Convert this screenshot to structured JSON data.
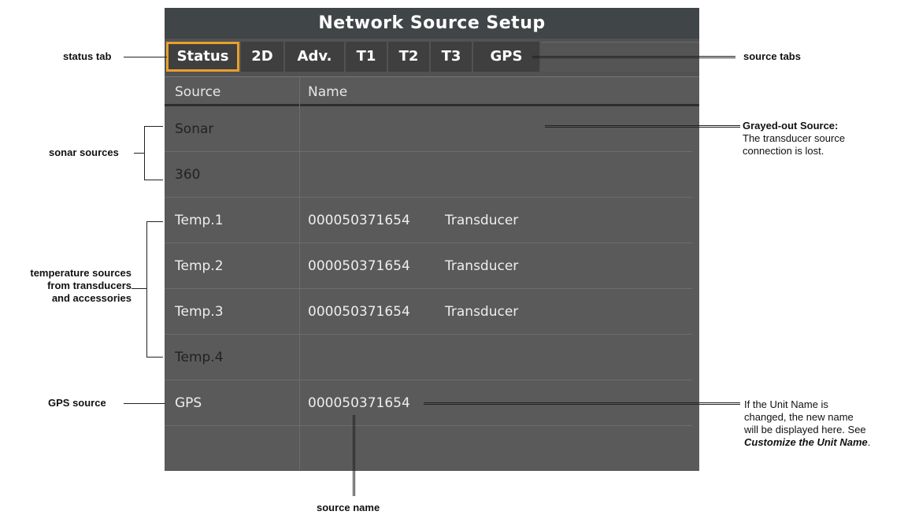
{
  "window": {
    "title": "Network Source Setup"
  },
  "tabs": [
    {
      "label": "Status",
      "active": true
    },
    {
      "label": "2D",
      "active": false
    },
    {
      "label": "Adv.",
      "active": false
    },
    {
      "label": "T1",
      "active": false
    },
    {
      "label": "T2",
      "active": false
    },
    {
      "label": "T3",
      "active": false
    },
    {
      "label": "GPS",
      "active": false
    }
  ],
  "table": {
    "columns": [
      "Source",
      "Name"
    ],
    "rows": [
      {
        "source": "Sonar",
        "id": "",
        "name": "",
        "grayed": true
      },
      {
        "source": "360",
        "id": "",
        "name": "",
        "grayed": true
      },
      {
        "source": "Temp.1",
        "id": "000050371654",
        "name": "Transducer",
        "grayed": false
      },
      {
        "source": "Temp.2",
        "id": "000050371654",
        "name": "Transducer",
        "grayed": false
      },
      {
        "source": "Temp.3",
        "id": "000050371654",
        "name": "Transducer",
        "grayed": false
      },
      {
        "source": "Temp.4",
        "id": "",
        "name": "",
        "grayed": true
      },
      {
        "source": "GPS",
        "id": "000050371654",
        "name": "",
        "grayed": false
      },
      {
        "source": "",
        "id": "",
        "name": "",
        "grayed": false
      }
    ]
  },
  "callouts": {
    "status_tab": "status tab",
    "source_tabs": "source tabs",
    "sonar_sources": "sonar sources",
    "temperature_sources": [
      "temperature sources",
      "from transducers",
      "and accessories"
    ],
    "gps_source": "GPS source",
    "source_name": "source name",
    "grayed_out_title": "Grayed-out Source:",
    "grayed_out_lines": [
      "The transducer source",
      "connection is lost."
    ],
    "unit_name_lines": [
      "If the Unit Name is",
      "changed, the new name",
      "will be displayed here. See"
    ],
    "unit_name_link": "Customize the Unit Name",
    "unit_name_end": "."
  },
  "colors": {
    "active_tab_border": "#e7a02d",
    "panel": "#5a5a5a",
    "titlebar": "#404547"
  }
}
